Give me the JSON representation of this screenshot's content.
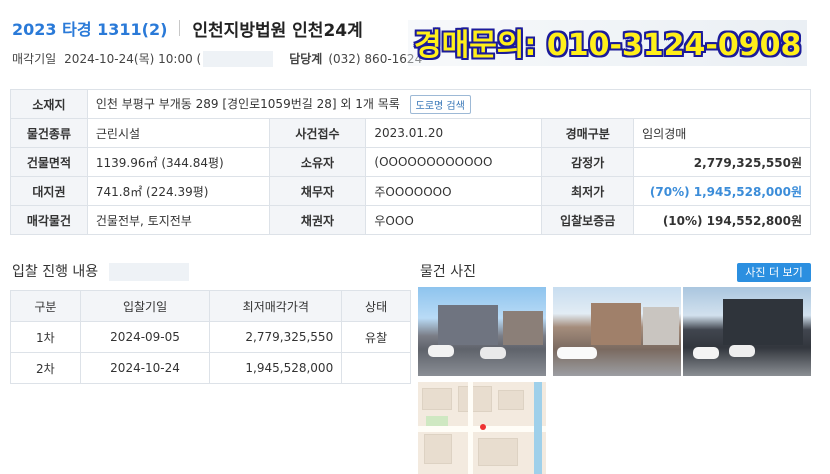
{
  "header": {
    "case_number": "2023 타경 1311(2)",
    "court": "인천지방법원 인천24계",
    "sale_date_label": "매각기일",
    "sale_date": "2024-10-24(목) 10:00 (",
    "dept_label": "담당계",
    "dept_phone": "(032) 860-1624",
    "inquiry": "경매문의: 010-3124-0908"
  },
  "info": {
    "address_label": "소재지",
    "address": "인천 부평구 부개동 289 [경인로1059번길 28] 외 1개 목록",
    "road_button": "도로명 검색",
    "type_label": "물건종류",
    "type": "근린시설",
    "filed_label": "사건접수",
    "filed": "2023.01.20",
    "auction_type_label": "경매구분",
    "auction_type": "임의경매",
    "building_area_label": "건물면적",
    "building_area": "1139.96㎡ (344.84평)",
    "owner_label": "소유자",
    "owner": "(OOOOOOOOOOOO",
    "appraisal_label": "감정가",
    "appraisal": "2,779,325,550원",
    "land_right_label": "대지권",
    "land_right": "741.8㎡ (224.39평)",
    "debtor_label": "채무자",
    "debtor": "주OOOOOOO",
    "min_price_label": "최저가",
    "min_price": "(70%) 1,945,528,000원",
    "sale_object_label": "매각물건",
    "sale_object": "건물전부, 토지전부",
    "creditor_label": "채권자",
    "creditor": "우OOO",
    "deposit_label": "입찰보증금",
    "deposit": "(10%) 194,552,800원"
  },
  "bids": {
    "title": "입찰 진행 내용",
    "headers": [
      "구분",
      "입찰기일",
      "최저매각가격",
      "상태"
    ],
    "rows": [
      [
        "1차",
        "2024-09-05",
        "2,779,325,550",
        "유찰"
      ],
      [
        "2차",
        "2024-10-24",
        "1,945,528,000",
        ""
      ]
    ]
  },
  "photos": {
    "title": "물건 사진",
    "more_button": "사진 더 보기"
  },
  "colors": {
    "accent": "#2a7ad8",
    "min_price": "#3c8dd9",
    "inquiry_text": "#ffef1a",
    "inquiry_outline": "#1b1b9a"
  }
}
